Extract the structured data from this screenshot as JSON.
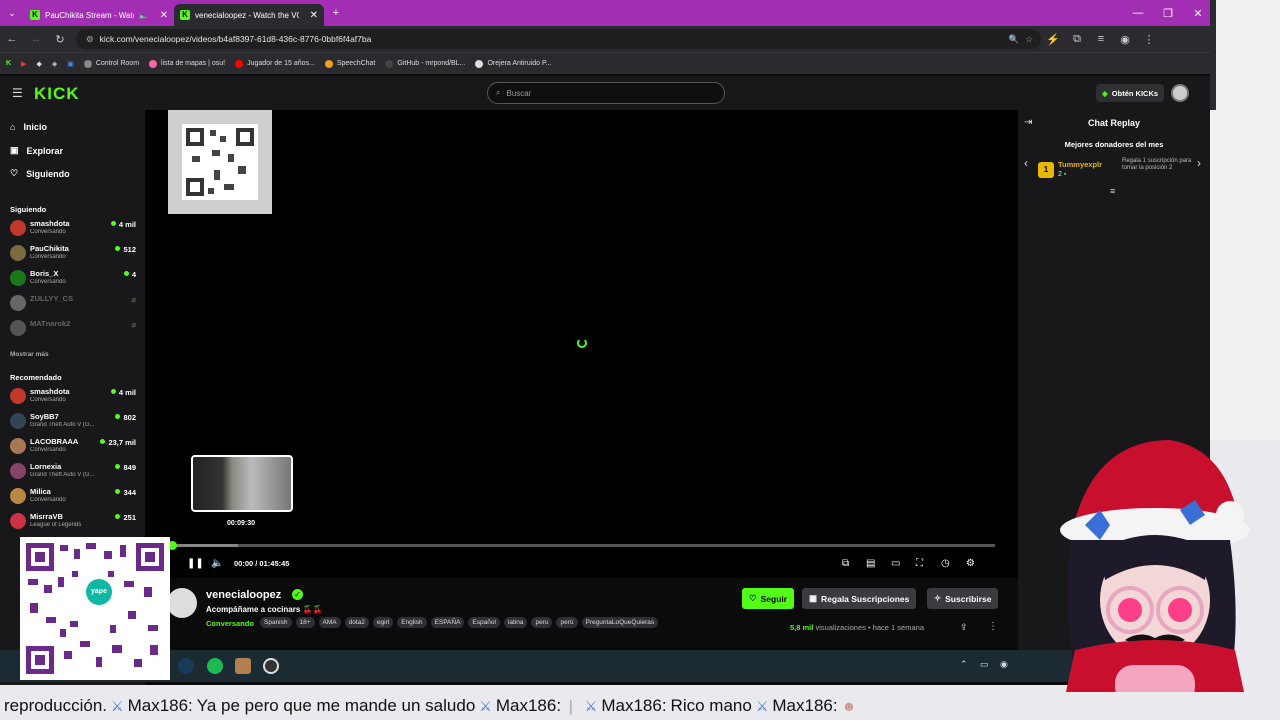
{
  "browser": {
    "tabs": [
      {
        "title": "PauChikita Stream - Watch"
      },
      {
        "title": "venecialoopez - Watch the VOD"
      }
    ],
    "url": "kick.com/venecialoopez/videos/b4af8397-61d8-436c-8776-0bbf6f4af7ba",
    "bookmarks": [
      {
        "label": "Control Room",
        "color": "#888888"
      },
      {
        "label": "lista de mapas | osu!",
        "color": "#ff66aa"
      },
      {
        "label": "Jugador de 15 años...",
        "color": "#ff0000"
      },
      {
        "label": "SpeechChat",
        "color": "#f0a020"
      },
      {
        "label": "GitHub - mrpond/BL...",
        "color": "#444444"
      },
      {
        "label": "Orejera Antiruido P...",
        "color": "#dddddd"
      }
    ]
  },
  "header": {
    "logo": "KICK",
    "search_placeholder": "Buscar",
    "kicks_label": "Obtén KICKs"
  },
  "sidebar": {
    "nav": [
      {
        "label": "Inicio",
        "icon": "home-icon"
      },
      {
        "label": "Explorar",
        "icon": "compass-icon"
      },
      {
        "label": "Siguiendo",
        "icon": "heart-icon"
      }
    ],
    "following_title": "Siguiendo",
    "following": [
      {
        "name": "smashdota",
        "category": "Conversando",
        "viewers": "4 mil",
        "color": "#c0392b",
        "online": true
      },
      {
        "name": "PauChikita",
        "category": "Conversando",
        "viewers": "512",
        "color": "#7a6a40",
        "online": true
      },
      {
        "name": "Boris_X",
        "category": "Conversando",
        "viewers": "4",
        "color": "#1a7a1a",
        "online": true
      },
      {
        "name": "ZULLYY_CS",
        "category": "",
        "viewers": "",
        "color": "#666666",
        "online": false
      },
      {
        "name": "MATnarok2",
        "category": "",
        "viewers": "",
        "color": "#555555",
        "online": false
      }
    ],
    "show_more": "Mostrar más",
    "recommended_title": "Recomendado",
    "recommended": [
      {
        "name": "smashdota",
        "category": "Conversando",
        "viewers": "4 mil",
        "color": "#c0392b"
      },
      {
        "name": "SoyBB7",
        "category": "Grand Theft Auto V (G...",
        "viewers": "802",
        "color": "#334455"
      },
      {
        "name": "LACOBRAAA",
        "category": "Conversando",
        "viewers": "23,7 mil",
        "color": "#aa7755"
      },
      {
        "name": "Lornexia",
        "category": "Grand Theft Auto V (G...",
        "viewers": "849",
        "color": "#884466"
      },
      {
        "name": "Milica",
        "category": "Conversando",
        "viewers": "344",
        "color": "#bb8844"
      },
      {
        "name": "MisrraVB",
        "category": "League of Legends",
        "viewers": "251",
        "color": "#cc3344"
      }
    ]
  },
  "player": {
    "thumb_time": "00:09:30",
    "current_time": "00:00",
    "duration": "01:45:45",
    "time_display": "00:00 / 01:45:45",
    "progress_fraction": 0.0,
    "buffered_fraction": 0.08,
    "hover_fraction": 0.09
  },
  "stream": {
    "channel": "venecialoopez",
    "title": "Acompáñame a cocinars 🍒🍒",
    "category": "Conversando",
    "tags": [
      "Spanish",
      "18+",
      "AMA",
      "dota2",
      "egirl",
      "English",
      "ESPAÑA",
      "Español",
      "latina",
      "peru",
      "perú",
      "PreguntaLoQueQuieras"
    ],
    "follow_label": "Seguir",
    "gift_label": "Regala Suscripciones",
    "subscribe_label": "Suscribirse",
    "views_count": "5,8 mil",
    "views_label": "visualizaciones",
    "age": "hace 1 semana"
  },
  "chat": {
    "title": "Chat Replay",
    "donors_title": "Mejores donadores del mes",
    "top_donor": {
      "rank": "1",
      "name": "Tummyexplr",
      "amount": "2"
    },
    "promo": "Regala 1 suscripción para tomar la posición 2"
  },
  "overlay": {
    "qr_brand": "yape",
    "ticker": [
      {
        "text": "reproducción."
      },
      {
        "user": "Max186:",
        "text": "Ya pe pero que me mande un saludo"
      },
      {
        "user": "Max186:",
        "text": ""
      },
      {
        "user": "Max186:",
        "text": "Rico mano"
      },
      {
        "user": "Max186:",
        "text": ""
      }
    ]
  },
  "colors": {
    "accent": "#53fc18",
    "tabstrip": "#a22fb3",
    "background": "#0b0b0c"
  }
}
